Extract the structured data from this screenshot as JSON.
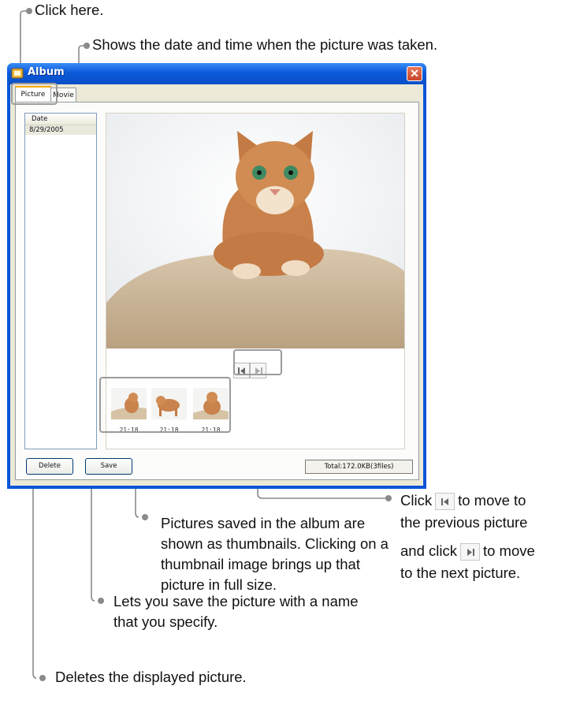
{
  "callouts": {
    "click_here": "Click here.",
    "date_info": "Shows the date and time when the picture was taken.",
    "prev_part1": "Click",
    "prev_part2": "to move to",
    "prev_part3": "the previous picture",
    "next_part1": "and click",
    "next_part2": "to move",
    "next_part3": "to the next picture.",
    "thumbnails": "Pictures saved in the album are shown as thumbnails. Clicking on a thumbnail image brings up that picture in full size.",
    "save": "Lets you save the picture with a name that you specify.",
    "delete": "Deletes the displayed picture."
  },
  "window": {
    "title": "Album",
    "close_glyph": "✕",
    "tabs": [
      {
        "label": "Picture"
      },
      {
        "label": "Movie"
      }
    ],
    "date_list": {
      "header": "Date",
      "rows": [
        "8/29/2005"
      ]
    },
    "thumbnails": [
      {
        "time": "21:18"
      },
      {
        "time": "21:18"
      },
      {
        "time": "21:18"
      }
    ],
    "buttons": {
      "delete": "Delete",
      "save": "Save"
    },
    "total": "Total:172.0KB(3files)"
  },
  "icons": {
    "prev": "previous-picture-icon",
    "next": "next-picture-icon"
  },
  "colors": {
    "titlebar": "#0a55d8",
    "close": "#d1502f",
    "highlight": "#9b9b9b",
    "leader": "#8a8a8a"
  }
}
